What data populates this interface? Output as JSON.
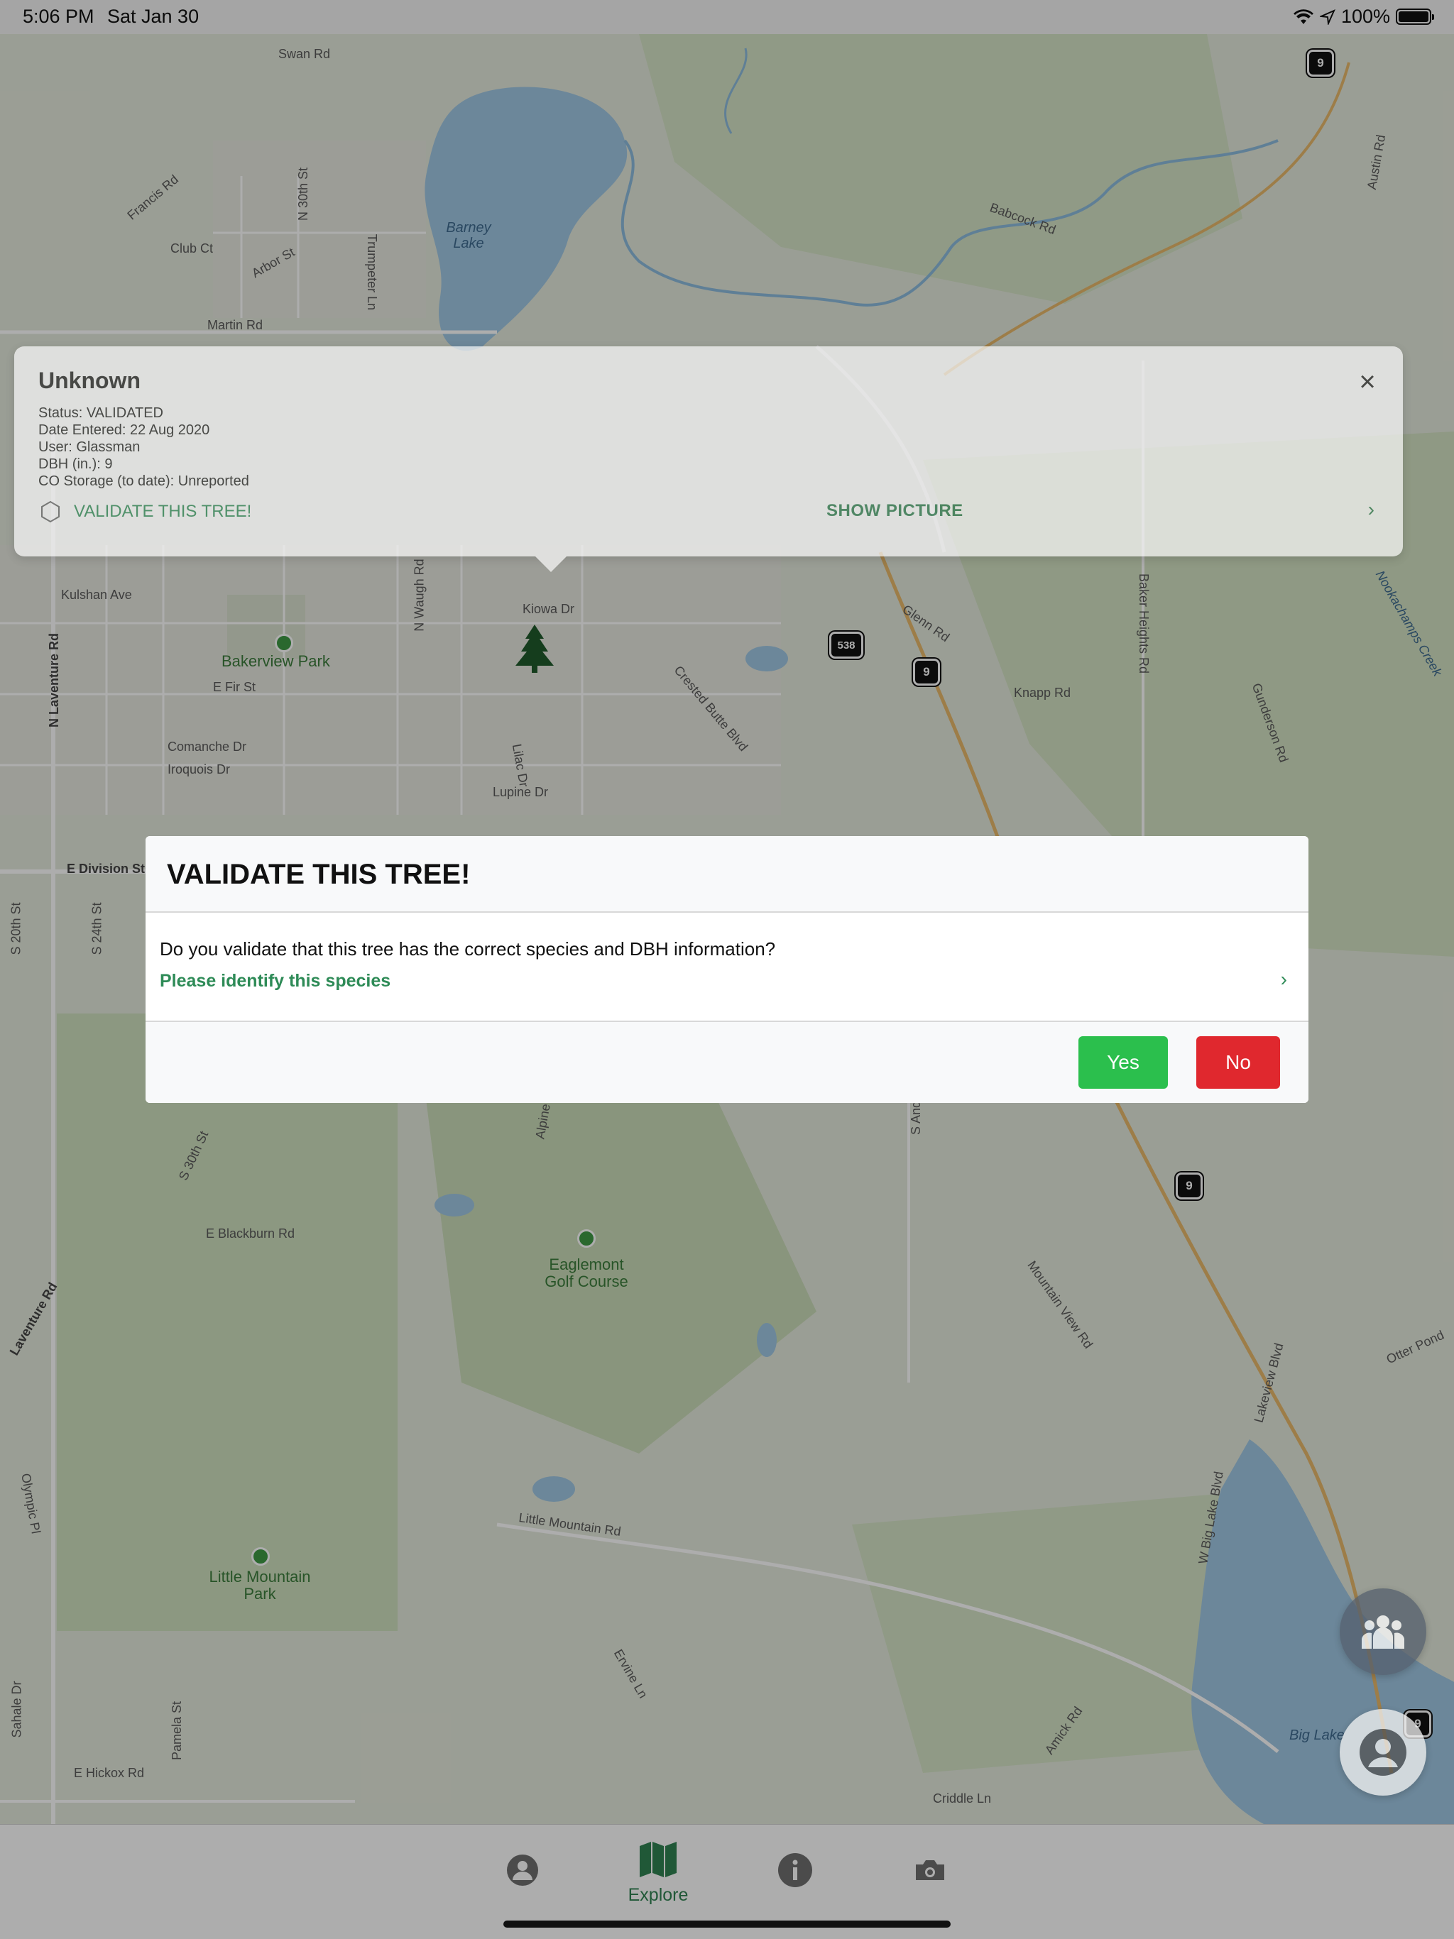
{
  "status_bar": {
    "time": "5:06 PM",
    "date": "Sat Jan 30",
    "battery": "100%"
  },
  "map": {
    "roads": [
      "Swan Rd",
      "Francis Rd",
      "N 30th St",
      "Club Ct",
      "Arbor St",
      "Trumpeter Ln",
      "Martin Rd",
      "Babcock Rd",
      "Austin Rd",
      "Kulshan Ave",
      "E Fir St",
      "N Waugh Rd",
      "Kiowa Dr",
      "Glenn Rd",
      "Crested Butte Blvd",
      "Knapp Rd",
      "Baker Heights Rd",
      "Gunderson Rd",
      "Comanche Dr",
      "Iroquois Dr",
      "Lilac Dr",
      "Lupine Dr",
      "E Division St",
      "S 24th St",
      "S 20th St",
      "E Blackburn Rd",
      "S 30th St",
      "Alpine View",
      "S Anderson Rd",
      "Mountain View Rd",
      "Little Mountain Rd",
      "Lakeview Blvd",
      "W Big Lake Blvd",
      "Otter Pond",
      "E Hickox Rd",
      "Pamela St",
      "Ervine Ln",
      "Amick Rd",
      "Criddle Ln",
      "N Laventure Rd",
      "Laventure Rd",
      "Olympic Pl",
      "Sahale Dr",
      "Nookachamps Creek"
    ],
    "parks": [
      "Bakerview Park",
      "Eaglemont Golf Course",
      "Little Mountain Park"
    ],
    "water": [
      "Barney Lake",
      "Big Lake"
    ],
    "highway_shields": [
      "9",
      "538",
      "9",
      "9",
      "9"
    ]
  },
  "info_card": {
    "title": "Unknown",
    "status": "Status: VALIDATED",
    "date_entered": "Date Entered: 22 Aug 2020",
    "user": "User: Glassman",
    "dbh": "DBH (in.): 9",
    "co_storage": "CO Storage (to date): Unreported",
    "validate_link": "VALIDATE THIS TREE!",
    "show_picture": "SHOW PICTURE"
  },
  "modal": {
    "title": "VALIDATE THIS TREE!",
    "question": "Do you validate that this tree has the correct species and DBH information?",
    "species_link": "Please identify this species",
    "yes": "Yes",
    "no": "No"
  },
  "tab_bar": {
    "tabs": [
      {
        "icon": "person-circle-icon",
        "label": ""
      },
      {
        "icon": "map-icon",
        "label": "Explore"
      },
      {
        "icon": "info-circle-icon",
        "label": ""
      },
      {
        "icon": "camera-icon",
        "label": ""
      }
    ],
    "active": "Explore",
    "accent": "#2e7d4f"
  },
  "colors": {
    "yes": "#2bbf4d",
    "no": "#e0282e",
    "green_link": "#2e8b57"
  }
}
